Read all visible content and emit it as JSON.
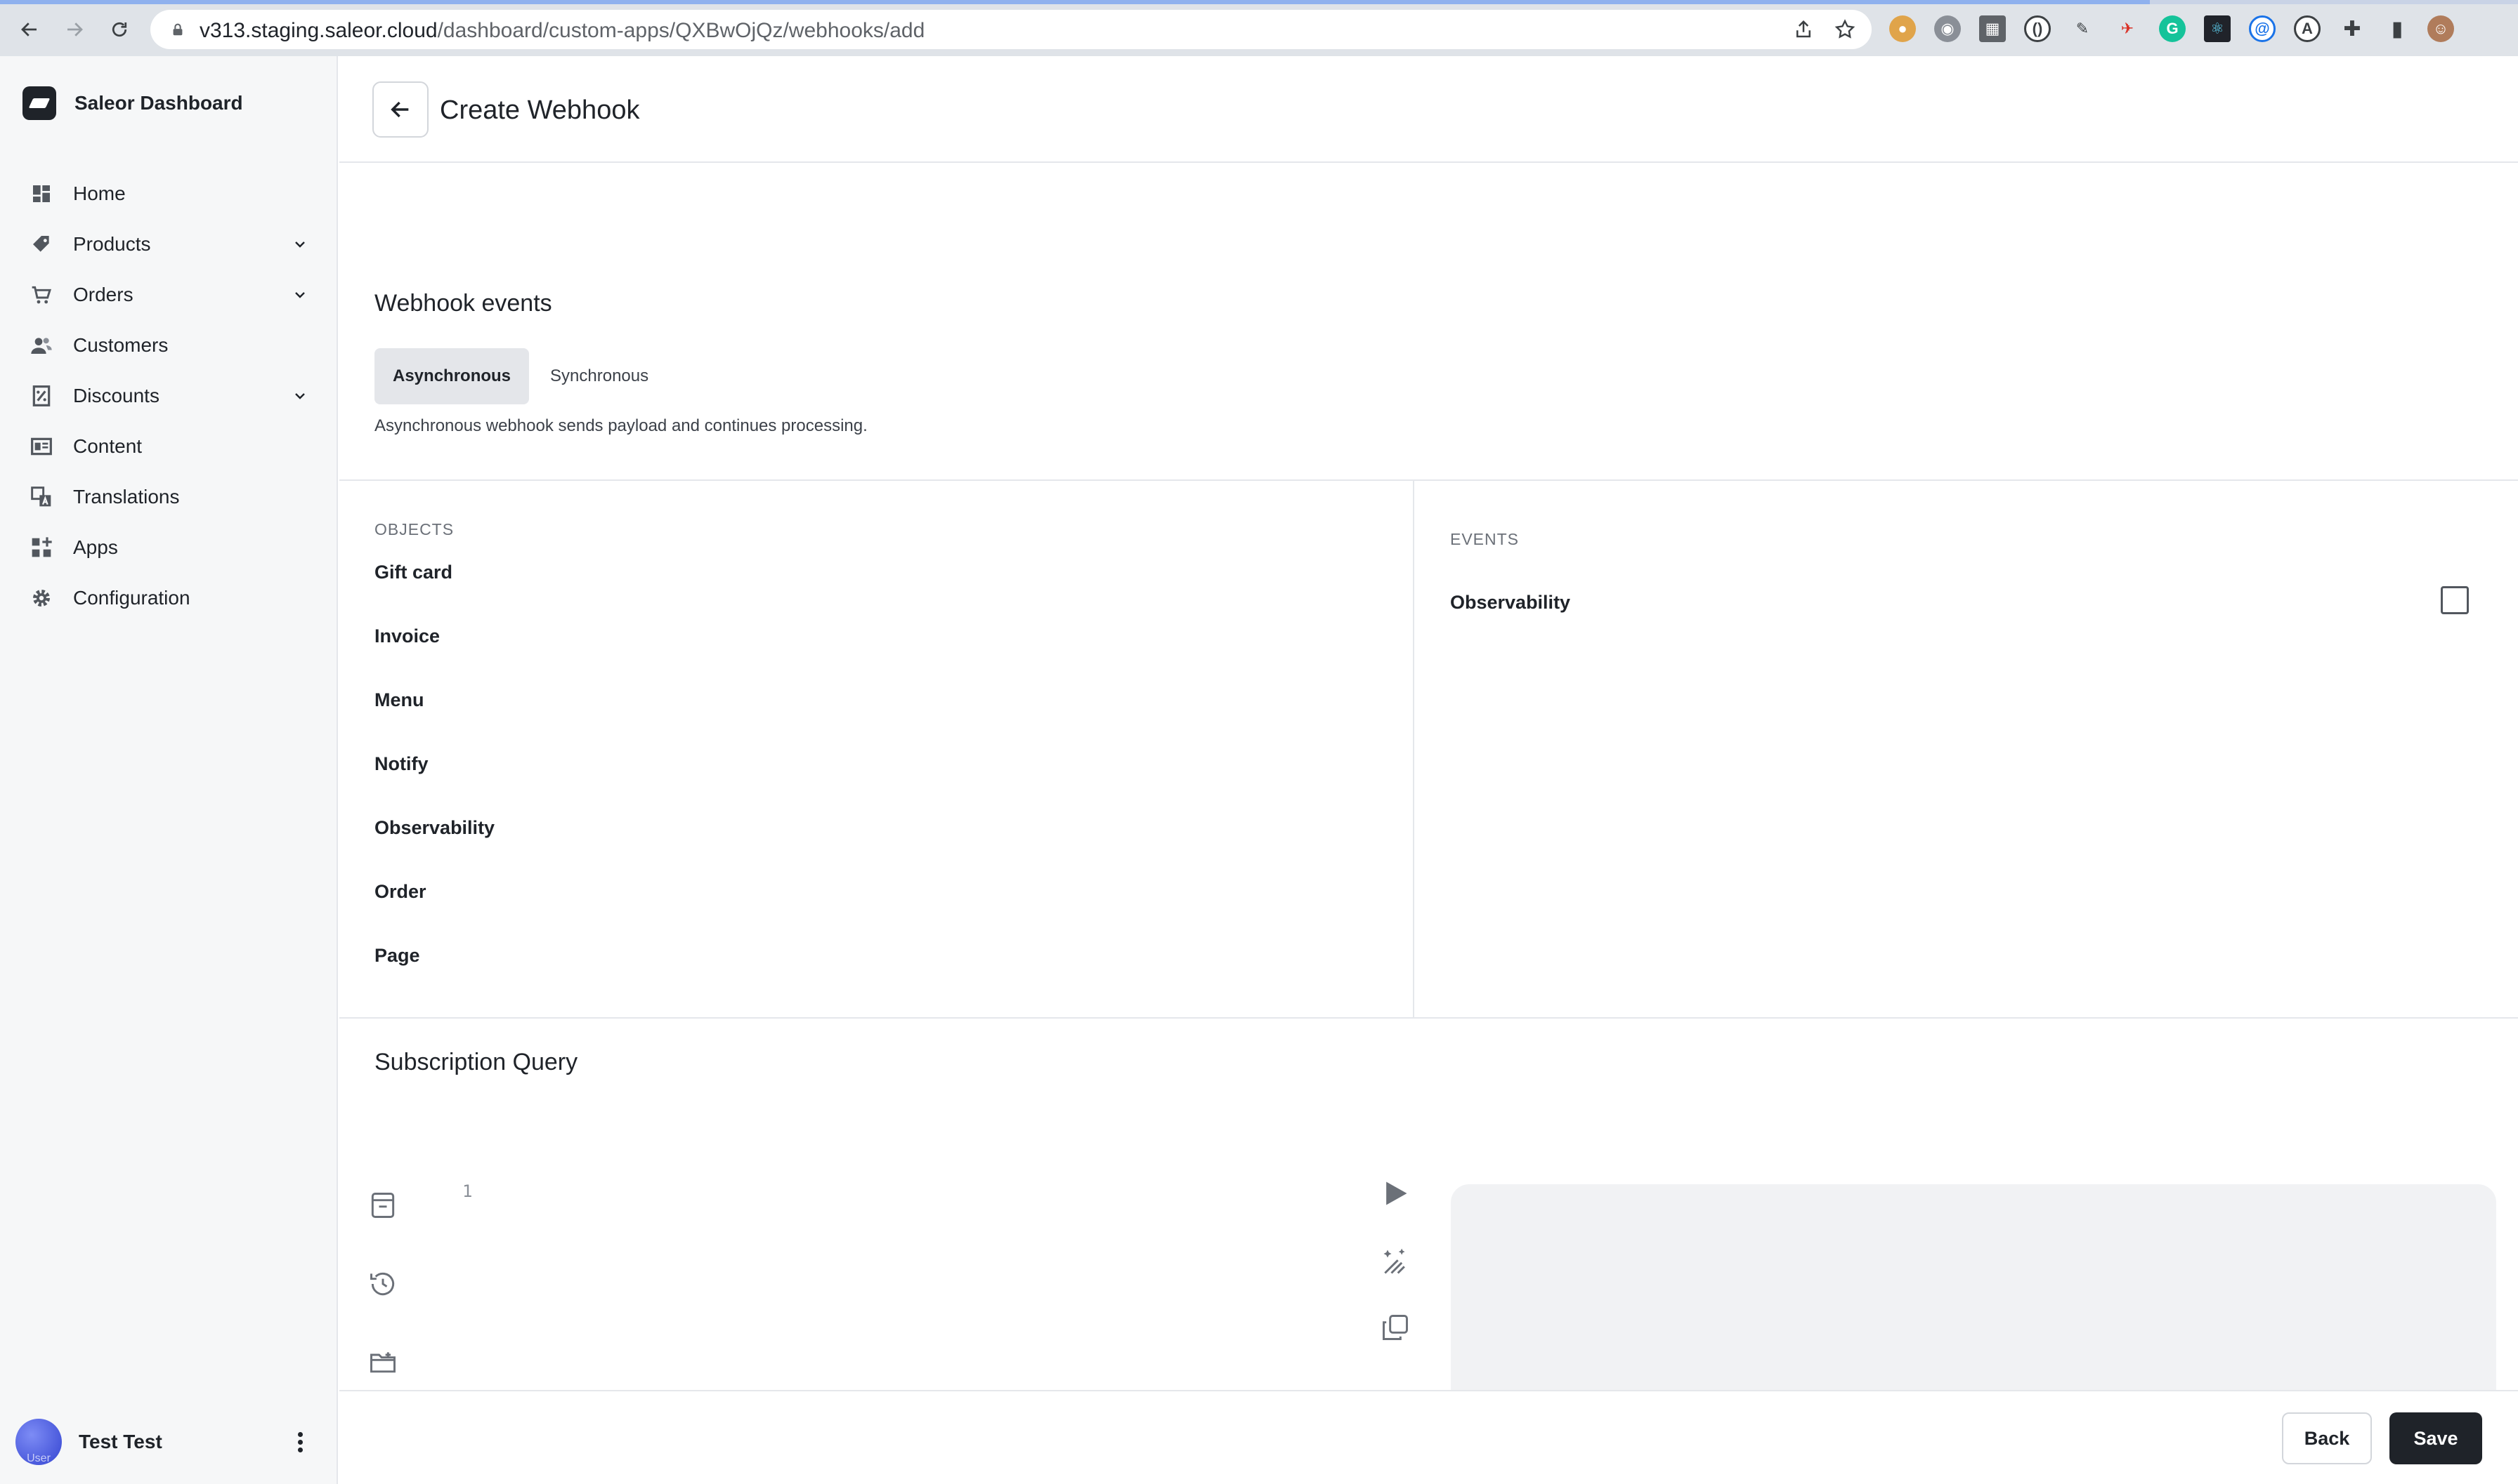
{
  "browser": {
    "url_host": "v313.staging.saleor.cloud",
    "url_path": "/dashboard/custom-apps/QXBwOjQz/webhooks/add"
  },
  "sidebar": {
    "brand": "Saleor Dashboard",
    "items": [
      {
        "label": "Home",
        "icon": "home-icon",
        "expandable": false
      },
      {
        "label": "Products",
        "icon": "tag-icon",
        "expandable": true
      },
      {
        "label": "Orders",
        "icon": "cart-icon",
        "expandable": true
      },
      {
        "label": "Customers",
        "icon": "users-icon",
        "expandable": false
      },
      {
        "label": "Discounts",
        "icon": "percent-icon",
        "expandable": true
      },
      {
        "label": "Content",
        "icon": "content-icon",
        "expandable": false
      },
      {
        "label": "Translations",
        "icon": "translate-icon",
        "expandable": false
      },
      {
        "label": "Apps",
        "icon": "apps-icon",
        "expandable": false
      },
      {
        "label": "Configuration",
        "icon": "gear-icon",
        "expandable": false
      }
    ],
    "user": {
      "name": "Test Test",
      "avatar_text": "User"
    }
  },
  "header": {
    "title": "Create Webhook"
  },
  "webhook_events": {
    "title": "Webhook events",
    "tabs": [
      {
        "label": "Asynchronous",
        "active": true
      },
      {
        "label": "Synchronous",
        "active": false
      }
    ],
    "description": "Asynchronous webhook sends payload and continues processing.",
    "objects_header": "OBJECTS",
    "objects": [
      "Gift card",
      "Invoice",
      "Menu",
      "Notify",
      "Observability",
      "Order",
      "Page"
    ],
    "events_header": "EVENTS",
    "events": [
      {
        "label": "Observability",
        "checked": false
      }
    ]
  },
  "subscription": {
    "title": "Subscription Query",
    "line_number": "1"
  },
  "footer": {
    "back_label": "Back",
    "save_label": "Save"
  },
  "colors": {
    "primary": "#1f2329",
    "active_tab_bg": "#e4e6ea",
    "result_pane_bg": "#f1f2f4"
  }
}
